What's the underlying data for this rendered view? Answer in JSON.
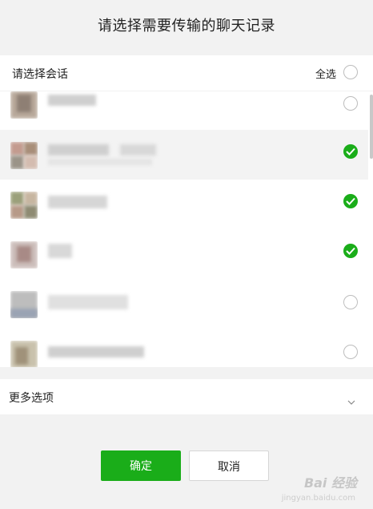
{
  "dialog": {
    "title": "请选择需要传输的聊天记录"
  },
  "select_header": {
    "label": "请选择会话",
    "select_all_label": "全选",
    "select_all_checked": false
  },
  "conversations": [
    {
      "checked": false
    },
    {
      "checked": true
    },
    {
      "checked": true
    },
    {
      "checked": true
    },
    {
      "checked": false
    },
    {
      "checked": false
    }
  ],
  "more_options": {
    "label": "更多选项",
    "icon": "chevron-down-icon"
  },
  "buttons": {
    "confirm": "确定",
    "cancel": "取消"
  },
  "watermark": {
    "text": "Bai 经验",
    "sub": "jingyan.baidu.com"
  },
  "colors": {
    "accent": "#1aad19",
    "background": "#f2f2f2"
  }
}
